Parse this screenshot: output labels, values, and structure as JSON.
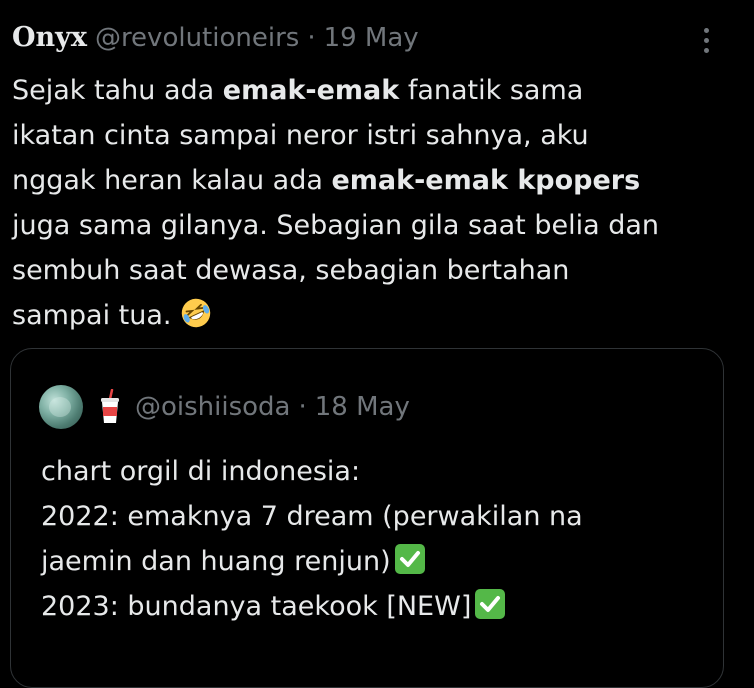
{
  "tweet": {
    "author_name": "Onyx",
    "handle": "@revolutioneirs",
    "separator": "·",
    "date": "19 May",
    "body": {
      "line1_a": "Sejak tahu ada ",
      "line1_b": "emak-emak",
      "line1_c": " fanatik sama",
      "line2": "ikatan cinta sampai neror istri sahnya, aku",
      "line3_a": "nggak heran kalau ada ",
      "line3_b": "emak-emak kpopers",
      "line4": "juga sama gilanya. Sebagian gila saat belia dan",
      "line5": "sembuh saat dewasa, sebagian bertahan",
      "line6": "sampai tua. "
    },
    "more_icon": "more-vertical-icon"
  },
  "quoted": {
    "handle": "@oishiisoda",
    "separator": "·",
    "date": "18 May",
    "lines": [
      "chart orgil di indonesia:",
      "2022: emaknya 7 dream (perwakilan na",
      "jaemin dan huang renjun)",
      "2023: bundanya taekook [NEW]"
    ],
    "badge_icon": "soda-cup-icon",
    "check_icon": "check-mark-button-icon"
  },
  "colors": {
    "background": "#000000",
    "text": "#e7e9ea",
    "muted": "#71767b",
    "border": "#2f3336",
    "check_green": "#54b848"
  }
}
